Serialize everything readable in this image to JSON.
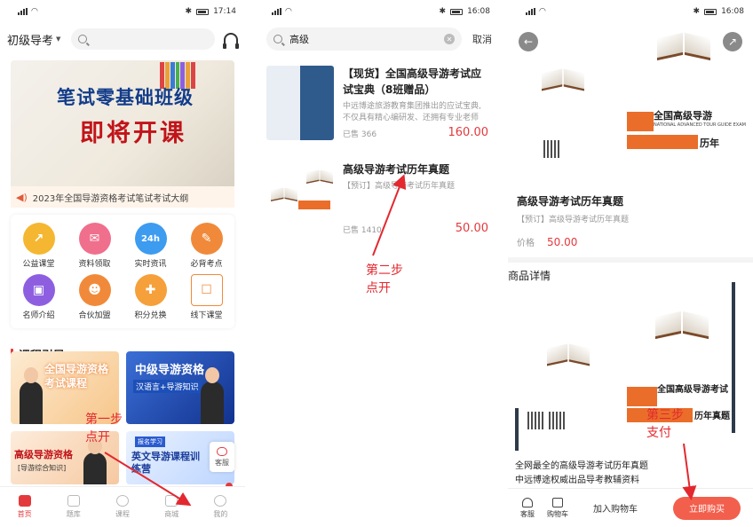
{
  "status": {
    "time_1": "17:14",
    "time_2": "16:08",
    "time_3": "16:08"
  },
  "screen1": {
    "level_select": "初级导考",
    "banner_line1": "笔试零基础班级",
    "banner_line2": "即将开课",
    "notice": "2023年全国导游资格考试笔试考试大纲",
    "grid": [
      {
        "label": "公益课堂",
        "color": "#f5b731"
      },
      {
        "label": "资料领取",
        "color": "#f06f8c"
      },
      {
        "label": "实时资讯",
        "color": "#3d9bf0",
        "badge": "24h"
      },
      {
        "label": "必背考点",
        "color": "#f08a3a"
      },
      {
        "label": "名师介绍",
        "color": "#8d5fe0"
      },
      {
        "label": "合伙加盟",
        "color": "#f08a3a"
      },
      {
        "label": "积分兑换",
        "color": "#f5a03a"
      },
      {
        "label": "线下课堂",
        "color": "#f08a3a"
      }
    ],
    "section_title": "课程引导",
    "cards": {
      "c1": "全国导游资格考试课程",
      "c2_title": "中级导游资格",
      "c2_sub": "汉语言+导游知识",
      "c3_title": "高级导游资格",
      "c3_sub": "[导游综合知识]",
      "c4_tag": "报名学习",
      "c4_title": "英文导游课程训练营"
    },
    "kefu": "客服",
    "tabs": [
      {
        "label": "首页",
        "active": true
      },
      {
        "label": "题库",
        "active": false
      },
      {
        "label": "课程",
        "active": false
      },
      {
        "label": "商城",
        "active": false
      },
      {
        "label": "我的",
        "active": false
      }
    ],
    "annotation_line1": "第一步",
    "annotation_line2": "点开"
  },
  "screen2": {
    "search_value": "高级",
    "cancel": "取消",
    "items": [
      {
        "title": "【现货】全国高级导游考试应试宝典（8班赠品）",
        "desc": "中远博途旅游教育集团推出的应试宝典,不仅具有精心编研发、还拥有专业老师",
        "sold": "已售 366",
        "price": "160.00"
      },
      {
        "title": "高级导游考试历年真题",
        "desc": "【预订】高级导游考试历年真题",
        "sold": "已售 1410",
        "price": "50.00"
      }
    ],
    "annotation_line1": "第二步",
    "annotation_line2": "点开"
  },
  "screen3": {
    "cover_title": "全国高级导游",
    "cover_sub": "历年",
    "cover_en": "NATIONAL ADVANCED TOUR GUIDE EXAM",
    "title": "高级导游考试历年真题",
    "preorder": "【预订】高级导游考试历年真题",
    "price_label": "价格",
    "price": "50.00",
    "detail_title": "商品详情",
    "detail_cover_title": "全国高级导游考试",
    "detail_cover_sub": "历年真题",
    "detail_text_1": "全网最全的高级导游考试历年真题",
    "detail_text_2": "中远博途权威出品导考教辅资料",
    "bottom": {
      "kefu": "客服",
      "cart": "购物车",
      "add_cart": "加入购物车",
      "buy": "立即购买"
    },
    "annotation_line1": "第三步",
    "annotation_line2": "支付"
  }
}
